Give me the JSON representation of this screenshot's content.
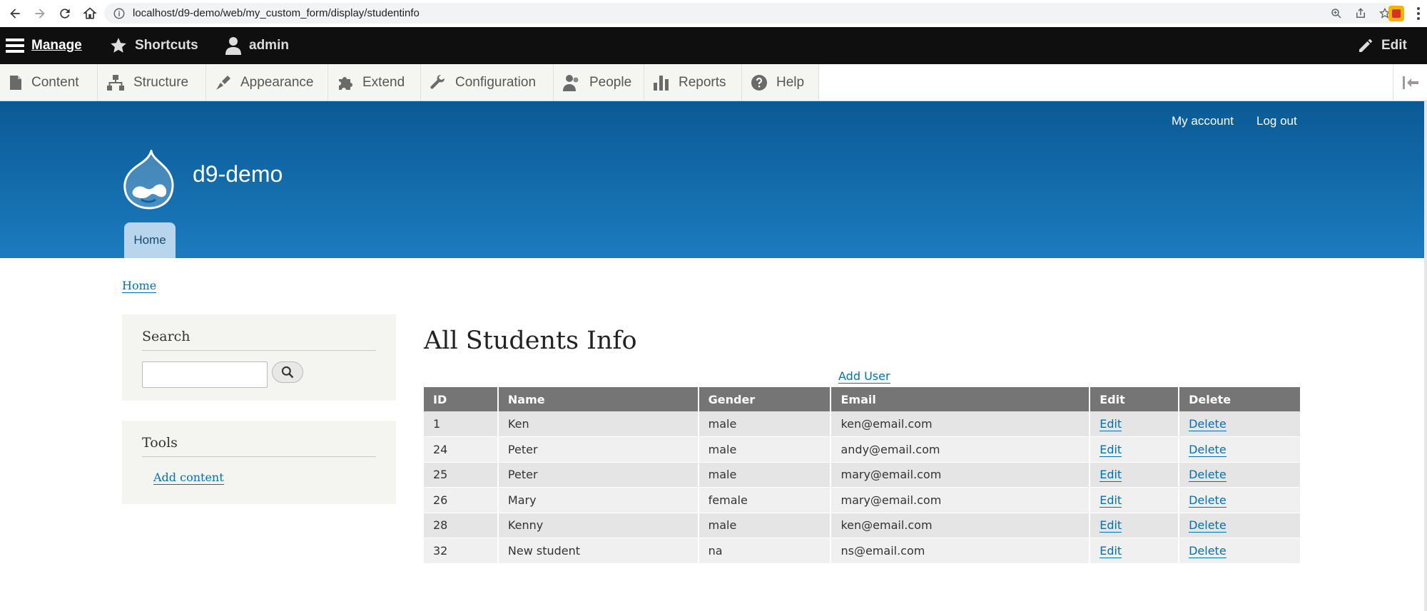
{
  "browser": {
    "url": "localhost/d9-demo/web/my_custom_form/display/studentinfo"
  },
  "toolbar": {
    "manage": "Manage",
    "shortcuts": "Shortcuts",
    "user": "admin",
    "edit": "Edit"
  },
  "admin_menu": {
    "items": [
      {
        "label": "Content",
        "icon": "file-icon"
      },
      {
        "label": "Structure",
        "icon": "sitemap-icon"
      },
      {
        "label": "Appearance",
        "icon": "brush-icon"
      },
      {
        "label": "Extend",
        "icon": "puzzle-icon"
      },
      {
        "label": "Configuration",
        "icon": "wrench-icon"
      },
      {
        "label": "People",
        "icon": "people-icon"
      },
      {
        "label": "Reports",
        "icon": "bar-chart-icon"
      },
      {
        "label": "Help",
        "icon": "help-icon"
      }
    ]
  },
  "header": {
    "site_name": "d9-demo",
    "my_account": "My account",
    "log_out": "Log out",
    "home_tab": "Home"
  },
  "breadcrumb": "Home",
  "sidebar": {
    "search_title": "Search",
    "tools_title": "Tools",
    "add_content": "Add content"
  },
  "main": {
    "title": "All Students Info",
    "add_user": "Add User",
    "columns": [
      "ID",
      "Name",
      "Gender",
      "Email",
      "Edit",
      "Delete"
    ],
    "rows": [
      {
        "id": "1",
        "name": "Ken",
        "gender": "male",
        "email": "ken@email.com",
        "edit": "Edit",
        "delete": "Delete"
      },
      {
        "id": "24",
        "name": "Peter",
        "gender": "male",
        "email": "andy@email.com",
        "edit": "Edit",
        "delete": "Delete"
      },
      {
        "id": "25",
        "name": "Peter",
        "gender": "male",
        "email": "mary@email.com",
        "edit": "Edit",
        "delete": "Delete"
      },
      {
        "id": "26",
        "name": "Mary",
        "gender": "female",
        "email": "mary@email.com",
        "edit": "Edit",
        "delete": "Delete"
      },
      {
        "id": "28",
        "name": "Kenny",
        "gender": "male",
        "email": "ken@email.com",
        "edit": "Edit",
        "delete": "Delete"
      },
      {
        "id": "32",
        "name": "New student",
        "gender": "na",
        "email": "ns@email.com",
        "edit": "Edit",
        "delete": "Delete"
      }
    ]
  },
  "colors": {
    "header_top": "#0a5a94",
    "header_bottom": "#1c7bbf",
    "link": "#0071b3",
    "table_header": "#757575",
    "toolbar": "#0f0f0f"
  }
}
